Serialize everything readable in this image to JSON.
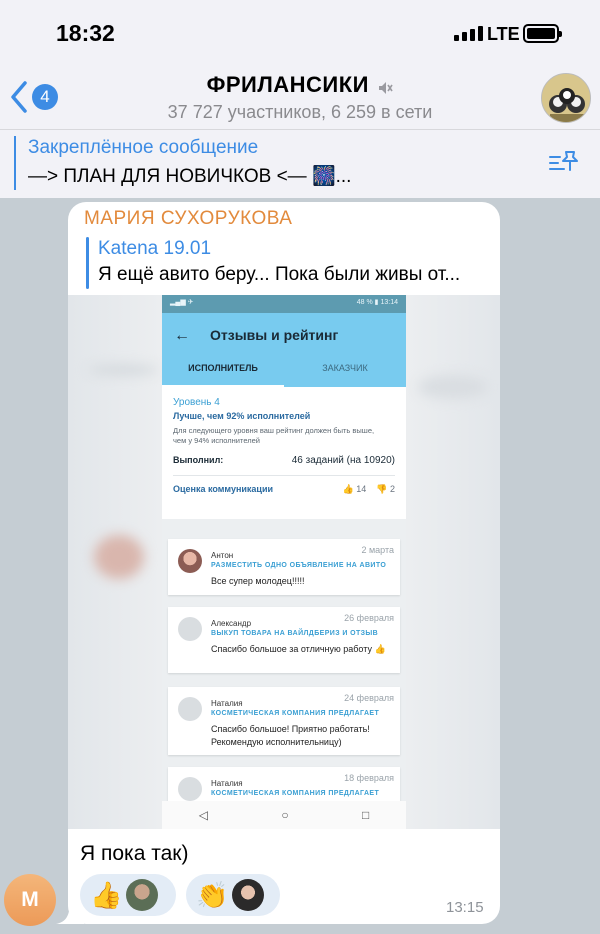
{
  "status_bar": {
    "time": "18:32",
    "network": "LTE"
  },
  "header": {
    "back_badge": "4",
    "title": "ФРИЛАНСИКИ",
    "subtitle": "37 727 участников, 6 259 в сети"
  },
  "pinned": {
    "title": "Закреплённое сообщение",
    "text": "—> ПЛАН ДЛЯ НОВИЧКОВ <— 🎆..."
  },
  "message": {
    "sender": "МАРИЯ СУХОРУКОВА",
    "reply": {
      "name": "Katena 19.01",
      "text": "Я ещё авито беру... Пока были живы от..."
    },
    "text": "Я пока так)",
    "time": "13:15",
    "avatar_letter": "M",
    "reactions": [
      {
        "emoji": "👍"
      },
      {
        "emoji": "👏"
      }
    ],
    "colors": {
      "sender": "#e28a3c",
      "accent": "#3d8ce4"
    },
    "screenshot": {
      "status_right": "48 % ▮ 13:14",
      "title": "Отзывы и рейтинг",
      "tabs": [
        "ИСПОЛНИТЕЛЬ",
        "ЗАКАЗЧИК"
      ],
      "level": "Уровень 4",
      "better": "Лучше, чем 92% исполнителей",
      "note": "Для следующего уровня ваш рейтинг должен быть выше, чем у 94% исполнителей",
      "done_label": "Выполнил:",
      "done_value": "46 заданий (на 10920)",
      "comm_label": "Оценка коммуникации",
      "likes": "14",
      "dislikes": "2",
      "reviews": [
        {
          "name": "Антон",
          "date": "2 марта",
          "service": "РАЗМЕСТИТЬ ОДНО ОБЪЯВЛЕНИЕ НА АВИТО",
          "text": "Все супер молодец!!!!!"
        },
        {
          "name": "Александр",
          "date": "26 февраля",
          "service": "ВЫКУП ТОВАРА НА ВАЙЛДБЕРИЗ И ОТЗЫВ",
          "text": "Спасибо большое за отличную работу 👍"
        },
        {
          "name": "Наталия",
          "date": "24 февраля",
          "service": "КОСМЕТИЧЕСКАЯ КОМПАНИЯ ПРЕДЛАГАЕТ",
          "text": "Спасибо большое! Приятно работать! Рекомендую исполнительницу)"
        },
        {
          "name": "Наталия",
          "date": "18 февраля",
          "service": "КОСМЕТИЧЕСКАЯ КОМПАНИЯ ПРЕДЛАГАЕТ",
          "text": ""
        }
      ]
    }
  }
}
